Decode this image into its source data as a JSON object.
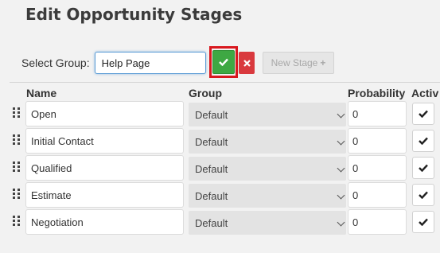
{
  "dialog": {
    "title": "Edit Opportunity Stages"
  },
  "group_selector": {
    "label": "Select Group:",
    "value": "Help Page",
    "confirm_icon": "check-icon",
    "cancel_icon": "times-icon",
    "new_stage_label": "New Stage",
    "new_stage_icon": "plus-icon"
  },
  "columns": {
    "name": "Name",
    "group": "Group",
    "probability": "Probability",
    "active": "Activ"
  },
  "stages": [
    {
      "name": "Open",
      "group": "Default",
      "probability": "0",
      "active": true
    },
    {
      "name": "Initial Contact",
      "group": "Default",
      "probability": "0",
      "active": true
    },
    {
      "name": "Qualified",
      "group": "Default",
      "probability": "0",
      "active": true
    },
    {
      "name": "Estimate",
      "group": "Default",
      "probability": "0",
      "active": true
    },
    {
      "name": "Negotiation",
      "group": "Default",
      "probability": "0",
      "active": true
    }
  ],
  "colors": {
    "confirm": "#3ea843",
    "cancel": "#d9393e",
    "highlight": "#d9181f"
  }
}
